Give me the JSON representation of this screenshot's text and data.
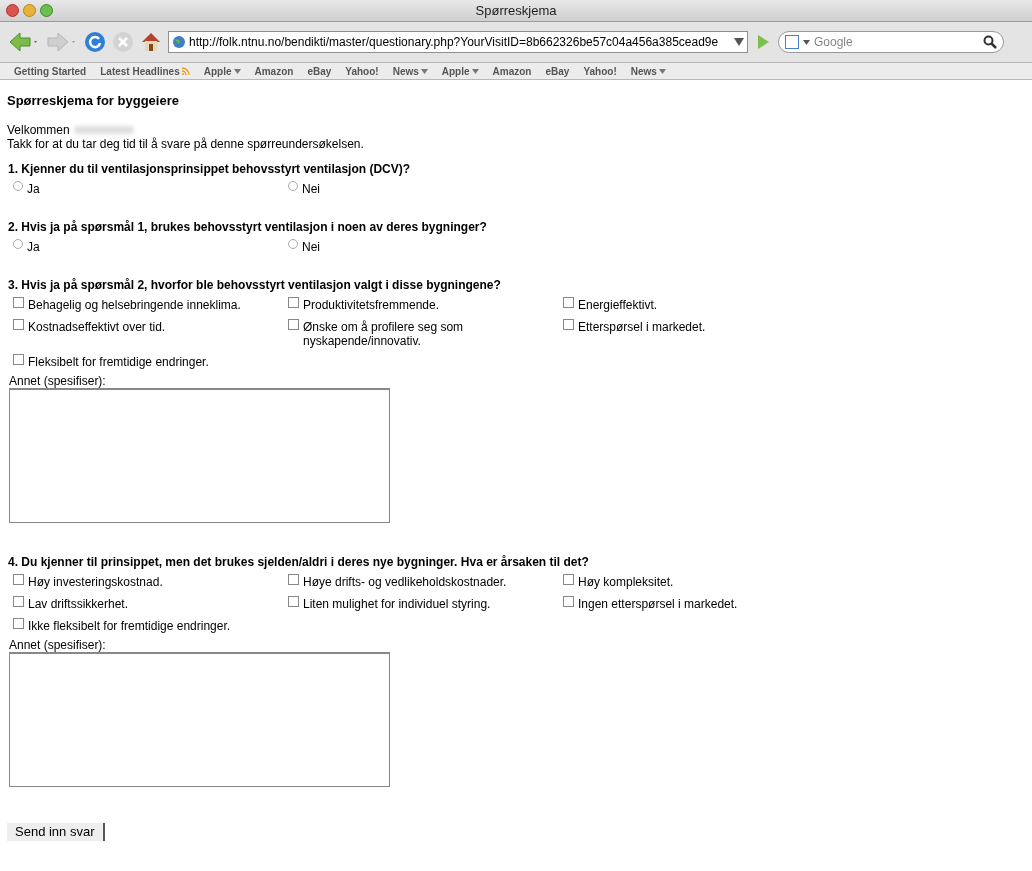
{
  "window": {
    "title": "Spørreskjema"
  },
  "toolbar": {
    "url": "http://folk.ntnu.no/bendikti/master/questionary.php?YourVisitID=8b662326be57c04a456a385cead9e",
    "search_placeholder": "Google"
  },
  "bookmarks": [
    {
      "label": "Getting Started",
      "kind": "link"
    },
    {
      "label": "Latest Headlines",
      "kind": "feed"
    },
    {
      "label": "Apple",
      "kind": "folder"
    },
    {
      "label": "Amazon",
      "kind": "link"
    },
    {
      "label": "eBay",
      "kind": "link"
    },
    {
      "label": "Yahoo!",
      "kind": "link"
    },
    {
      "label": "News",
      "kind": "folder"
    },
    {
      "label": "Apple",
      "kind": "folder"
    },
    {
      "label": "Amazon",
      "kind": "link"
    },
    {
      "label": "eBay",
      "kind": "link"
    },
    {
      "label": "Yahoo!",
      "kind": "link"
    },
    {
      "label": "News",
      "kind": "folder"
    }
  ],
  "page": {
    "heading": "Spørreskjema for byggeiere",
    "welcome": "Velkommen",
    "thanks": "Takk for at du tar deg tid til å svare på denne spørreundersøkelsen.",
    "questions": [
      {
        "title": "1. Kjenner du til ventilasjonsprinsippet behovsstyrt ventilasjon (DCV)?",
        "kind": "radio",
        "options": [
          {
            "label": "Ja",
            "selected": false
          },
          {
            "label": "Nei",
            "selected": false
          }
        ]
      },
      {
        "title": "2. Hvis ja på spørsmål 1, brukes behovsstyrt ventilasjon i noen av deres bygninger?",
        "kind": "radio",
        "options": [
          {
            "label": "Ja",
            "selected": false
          },
          {
            "label": "Nei",
            "selected": false
          }
        ]
      },
      {
        "title": "3. Hvis ja på spørsmål 2, hvorfor ble behovsstyrt ventilasjon valgt i disse bygningene?",
        "kind": "checkbox",
        "options": [
          {
            "label": "Behagelig og helsebringende inneklima.",
            "checked": false
          },
          {
            "label": "Produktivitetsfremmende.",
            "checked": false
          },
          {
            "label": "Energieffektivt.",
            "checked": false
          },
          {
            "label": "Kostnadseffektivt over tid.",
            "checked": false
          },
          {
            "label": "Ønske om å profilere seg som nyskapende/innovativ.",
            "checked": false
          },
          {
            "label": "Etterspørsel i markedet.",
            "checked": false
          },
          {
            "label": "Fleksibelt for fremtidige endringer.",
            "checked": false
          }
        ],
        "other_label": "Annet (spesifiser):"
      },
      {
        "title": "4. Du kjenner til prinsippet, men det brukes sjelden/aldri i deres nye bygninger. Hva er årsaken til det?",
        "kind": "checkbox",
        "options": [
          {
            "label": "Høy investeringskostnad.",
            "checked": false
          },
          {
            "label": "Høye drifts- og vedlikeholdskostnader.",
            "checked": false
          },
          {
            "label": "Høy kompleksitet.",
            "checked": false
          },
          {
            "label": "Lav driftssikkerhet.",
            "checked": false
          },
          {
            "label": "Liten mulighet for individuel styring.",
            "checked": false
          },
          {
            "label": "Ingen etterspørsel i markedet.",
            "checked": false
          },
          {
            "label": "Ikke fleksibelt for fremtidige endringer.",
            "checked": false
          }
        ],
        "other_label": "Annet (spesifiser):"
      }
    ],
    "submit": "Send inn svar"
  }
}
